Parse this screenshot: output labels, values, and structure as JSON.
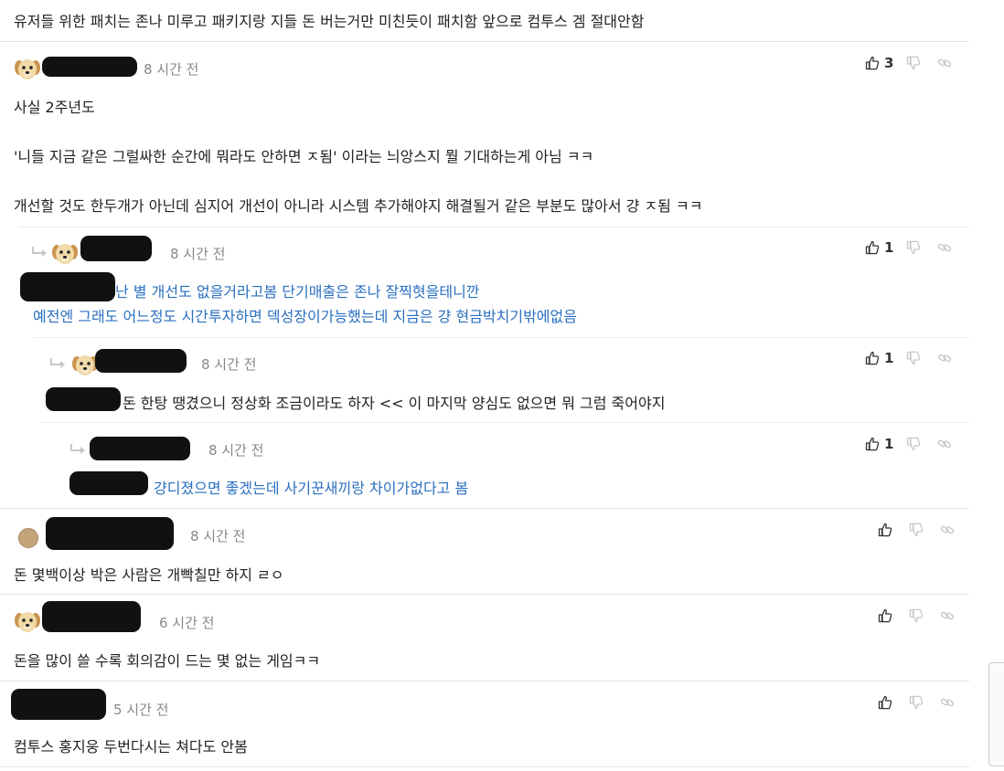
{
  "top_text": "유저들 위한 패치는 존나 미루고 패키지랑 지들 돈 버는거만 미친듯이 패치함 앞으로 컴투스 겜 절대안함",
  "comments": [
    {
      "time": "8 시간 전",
      "likes": "3",
      "body": [
        "사실 2주년도",
        "'니들 지금 같은 그럴싸한 순간에 뭐라도 안하면 ㅈ됨' 이라는 늬앙스지 뭘 기대하는게 아님 ㅋㅋ",
        "개선할 것도 한두개가 아닌데 심지어 개선이 아니라 시스템 추가해야지 해결될거 같은 부분도 많아서 걍 ㅈ됨 ㅋㅋ"
      ]
    },
    {
      "time": "8 시간 전",
      "likes": "1",
      "body": [
        "난 별 개선도 없을거라고봄 단기매출은 존나 잘찍혓을테니깐",
        "예전엔 그래도 어느정도 시간투자하면 덱성장이가능했는데 지금은 걍 현금박치기밖에없음"
      ]
    },
    {
      "time": "8 시간 전",
      "likes": "1",
      "body": [
        "돈 한탕 땡겼으니 정상화 조금이라도 하자 << 이 마지막 양심도 없으면 뭐 그럼 죽어야지"
      ]
    },
    {
      "time": "8 시간 전",
      "likes": "1",
      "body": [
        "걍디졌으면 좋겠는데 사기꾼새끼랑 차이가없다고 봄"
      ]
    },
    {
      "time": "8 시간 전",
      "likes": "",
      "body": [
        "돈 몇백이상 박은 사람은 개빡칠만 하지 ㄹㅇ"
      ]
    },
    {
      "time": "6 시간 전",
      "likes": "",
      "body": [
        "돈을 많이 쓸 수록 회의감이 드는 몇 없는 게임ㅋㅋ"
      ]
    },
    {
      "time": "5 시간 전",
      "likes": "",
      "body": [
        "컴투스 홍지웅 두번다시는 쳐다도 안봄"
      ]
    }
  ],
  "icons": [
    "thumbs-up-icon",
    "thumbs-down-icon",
    "link-icon",
    "reply-arrow-icon",
    "dog-avatar-icon",
    "circle-avatar-icon"
  ],
  "colors": {
    "reply_text": "#2a6fc0",
    "time": "#888888",
    "separator": "#e4e4e4"
  }
}
